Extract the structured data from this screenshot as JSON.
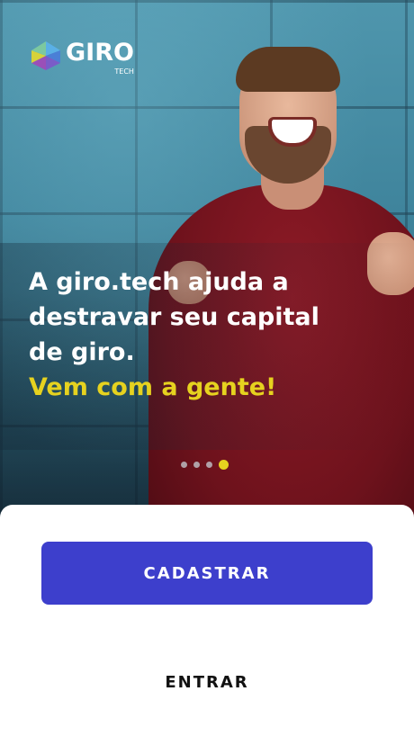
{
  "brand": {
    "name": "GIRO",
    "suffix": "TECH",
    "logo_icon": "giro-logo-icon"
  },
  "hero": {
    "headline_lines": [
      "A giro.tech ajuda a",
      "destravar seu capital",
      "de giro."
    ],
    "accent_line": "Vem com a gente!",
    "image": "smiling-man-photo"
  },
  "pager": {
    "total": 4,
    "active_index": 3
  },
  "actions": {
    "signup_label": "CADASTRAR",
    "login_label": "ENTRAR"
  },
  "colors": {
    "primary": "#3d3fcc",
    "accent": "#e6d21f",
    "text_on_dark": "#ffffff",
    "text_dark": "#111111"
  }
}
